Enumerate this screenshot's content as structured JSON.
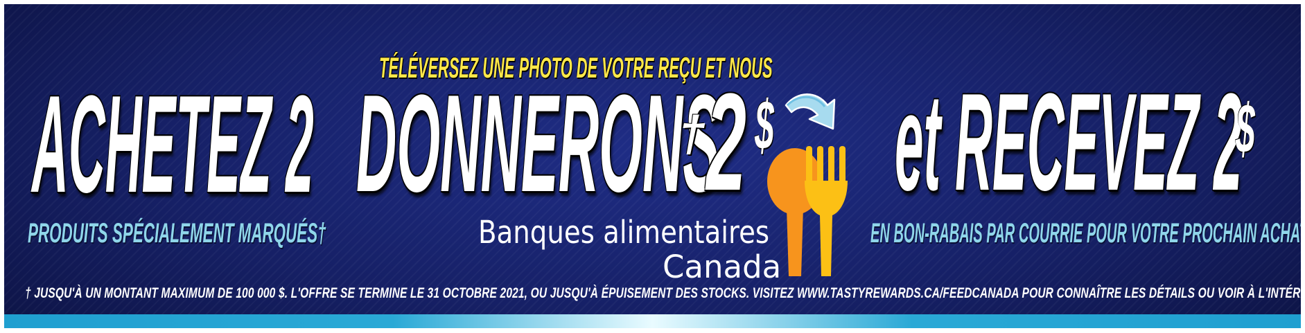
{
  "headline": {
    "buy": "ACHETEZ 2",
    "donate": "DONNERONS",
    "dagger": "†",
    "donate_amount": "2",
    "dollar": "$",
    "receive": "et RECEVEZ 2",
    "receive_dollar": "$"
  },
  "top_line": "TÉLÉVERSEZ UNE PHOTO DE VOTRE REÇU ET NOUS",
  "left_sub": "PRODUITS SPÉCIALEMENT MARQUÉS†",
  "right_sub": "EN BON-RABAIS PAR COURRIE POUR VOTRE PROCHAIN ACHAT",
  "logo": {
    "line1": "Banques alimentaires",
    "line2": "Canada"
  },
  "footnote": "† JUSQU'À UN MONTANT MAXIMUM DE 100 000 $. L'OFFRE SE TERMINE LE 31 OCTOBRE 2021, OU JUSQU'À ÉPUISEMENT DES STOCKS. VISITEZ WWW.TASTYREWARDS.CA/FEEDCANADA POUR CONNAÎTRE LES DÉTAILS OU VOIR À L'INTÉRIEUR DE LA BOÎTE.",
  "colors": {
    "background": "#162066",
    "sub_text": "#8fd6ea",
    "highlight": "#ffe84a",
    "spoon": "#f7941d",
    "fork": "#fcc015",
    "stripe": "#2aa9d6"
  },
  "icons": [
    "curved-arrow-icon",
    "spoon-icon",
    "fork-icon"
  ]
}
